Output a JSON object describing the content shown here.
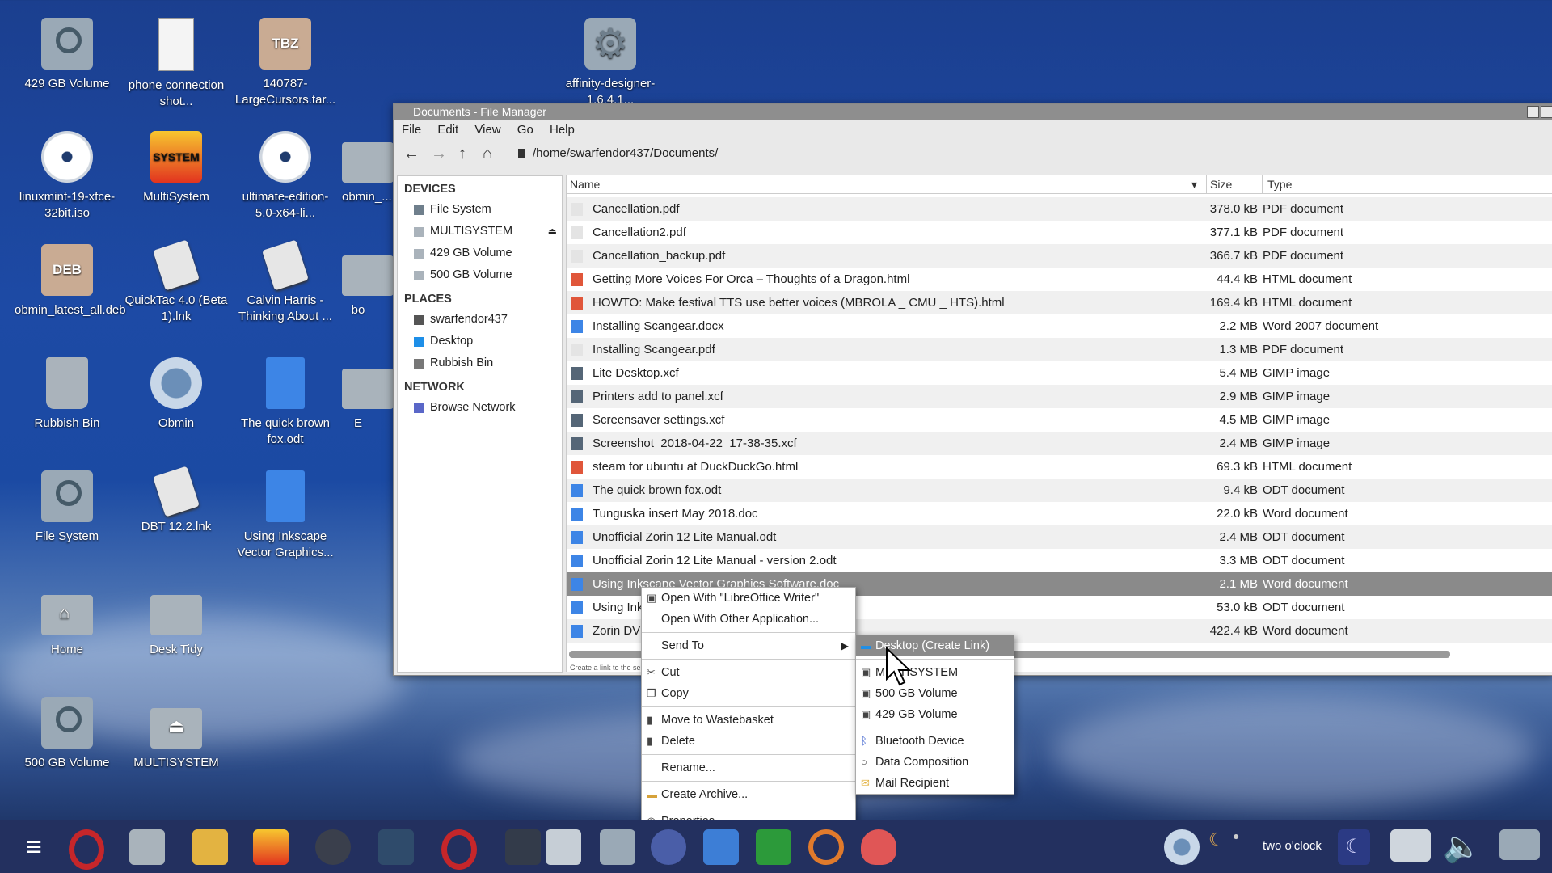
{
  "desktop": {
    "icons": [
      {
        "label": "429 GB Volume",
        "icon": "drive-icon"
      },
      {
        "label": "phone connection shot...",
        "icon": "image-file-icon"
      },
      {
        "label": "140787-LargeCursors.tar...",
        "icon": "archive-tbz-icon",
        "badge": "TBZ"
      },
      {
        "label": "affinity-designer-1.6.4.1...",
        "icon": "gear-icon"
      },
      {
        "label": "linuxmint-19-xfce-32bit.iso",
        "icon": "disc-icon"
      },
      {
        "label": "MultiSystem",
        "icon": "multisystem-icon",
        "badge": "SYSTEM"
      },
      {
        "label": "ultimate-edition-5.0-x64-li...",
        "icon": "disc-icon"
      },
      {
        "label": "obmin_...",
        "icon": "folder-icon"
      },
      {
        "label": "obmin_latest_all.deb",
        "icon": "deb-package-icon",
        "badge": "DEB"
      },
      {
        "label": "QuickTac 4.0 (Beta 1).lnk",
        "icon": "link-file-icon"
      },
      {
        "label": "Calvin Harris - Thinking About ...",
        "icon": "link-file-icon"
      },
      {
        "label": "bo",
        "icon": "folder-icon"
      },
      {
        "label": "Rubbish Bin",
        "icon": "trash-icon"
      },
      {
        "label": "Obmin",
        "icon": "obmin-icon"
      },
      {
        "label": "The quick brown fox.odt",
        "icon": "document-icon"
      },
      {
        "label": "E",
        "icon": "folder-icon"
      },
      {
        "label": "File System",
        "icon": "drive-icon"
      },
      {
        "label": "DBT 12.2.lnk",
        "icon": "link-file-icon"
      },
      {
        "label": "Using Inkscape Vector Graphics...",
        "icon": "document-icon"
      },
      {
        "label": "Home",
        "icon": "home-folder-icon"
      },
      {
        "label": "Desk Tidy",
        "icon": "folder-icon"
      },
      {
        "label": "500 GB Volume",
        "icon": "drive-icon"
      },
      {
        "label": "MULTISYSTEM",
        "icon": "eject-drive-icon"
      }
    ]
  },
  "window": {
    "title": "Documents - File Manager",
    "menu": [
      "File",
      "Edit",
      "View",
      "Go",
      "Help"
    ],
    "path": "/home/swarfendor437/Documents/",
    "sidebar": {
      "devices_title": "DEVICES",
      "devices": [
        "File System",
        "MULTISYSTEM",
        "429 GB Volume",
        "500 GB Volume"
      ],
      "places_title": "PLACES",
      "places": [
        "swarfendor437",
        "Desktop",
        "Rubbish Bin"
      ],
      "network_title": "NETWORK",
      "network": [
        "Browse Network"
      ]
    },
    "columns": {
      "name": "Name",
      "size": "Size",
      "type": "Type"
    },
    "files": [
      {
        "name": "Cancellation.pdf",
        "size": "378.0 kB",
        "type": "PDF document",
        "icon": "pdf-icon"
      },
      {
        "name": "Cancellation2.pdf",
        "size": "377.1 kB",
        "type": "PDF document",
        "icon": "pdf-icon"
      },
      {
        "name": "Cancellation_backup.pdf",
        "size": "366.7 kB",
        "type": "PDF document",
        "icon": "pdf-icon"
      },
      {
        "name": "Getting More Voices For Orca – Thoughts of a Dragon.html",
        "size": "44.4 kB",
        "type": "HTML document",
        "icon": "html-icon"
      },
      {
        "name": "HOWTO: Make festival TTS use better voices (MBROLA _ CMU _ HTS).html",
        "size": "169.4 kB",
        "type": "HTML document",
        "icon": "html-icon"
      },
      {
        "name": "Installing Scangear.docx",
        "size": "2.2 MB",
        "type": "Word 2007 document",
        "icon": "word-icon"
      },
      {
        "name": "Installing Scangear.pdf",
        "size": "1.3 MB",
        "type": "PDF document",
        "icon": "pdf-icon"
      },
      {
        "name": "Lite Desktop.xcf",
        "size": "5.4 MB",
        "type": "GIMP image",
        "icon": "gimp-icon"
      },
      {
        "name": "Printers add to panel.xcf",
        "size": "2.9 MB",
        "type": "GIMP image",
        "icon": "gimp-icon"
      },
      {
        "name": "Screensaver settings.xcf",
        "size": "4.5 MB",
        "type": "GIMP image",
        "icon": "gimp-icon"
      },
      {
        "name": "Screenshot_2018-04-22_17-38-35.xcf",
        "size": "2.4 MB",
        "type": "GIMP image",
        "icon": "gimp-icon"
      },
      {
        "name": "steam for ubuntu at DuckDuckGo.html",
        "size": "69.3 kB",
        "type": "HTML document",
        "icon": "html-icon"
      },
      {
        "name": "The quick brown fox.odt",
        "size": "9.4 kB",
        "type": "ODT document",
        "icon": "odt-icon"
      },
      {
        "name": "Tunguska insert May 2018.doc",
        "size": "22.0 kB",
        "type": "Word document",
        "icon": "word-icon"
      },
      {
        "name": "Unofficial Zorin 12 Lite Manual.odt",
        "size": "2.4 MB",
        "type": "ODT document",
        "icon": "odt-icon"
      },
      {
        "name": "Unofficial Zorin 12 Lite Manual - version 2.odt",
        "size": "3.3 MB",
        "type": "ODT document",
        "icon": "odt-icon"
      },
      {
        "name": "Using Inkscape Vector Graphics Software.doc",
        "size": "2.1 MB",
        "type": "Word document",
        "icon": "word-icon",
        "selected": true
      },
      {
        "name": "Using Ink",
        "size": "53.0 kB",
        "type": "ODT document",
        "icon": "odt-icon"
      },
      {
        "name": "Zorin DV",
        "size": "422.4 kB",
        "type": "Word document",
        "icon": "word-icon"
      }
    ],
    "status": "Create a link to the se..."
  },
  "context_menu": {
    "items": [
      {
        "label": "Open With \"LibreOffice Writer\"",
        "icon": "writer-icon"
      },
      {
        "label": "Open With Other Application...",
        "icon": ""
      },
      {
        "sep": true
      },
      {
        "label": "Send To",
        "icon": "",
        "submenu": true
      },
      {
        "sep": true
      },
      {
        "label": "Cut",
        "icon": "cut-icon"
      },
      {
        "label": "Copy",
        "icon": "copy-icon"
      },
      {
        "sep": true
      },
      {
        "label": "Move to Wastebasket",
        "icon": "trash-icon"
      },
      {
        "label": "Delete",
        "icon": "delete-icon"
      },
      {
        "sep": true
      },
      {
        "label": "Rename...",
        "icon": ""
      },
      {
        "sep": true
      },
      {
        "label": "Create Archive...",
        "icon": "archive-icon"
      },
      {
        "sep": true
      },
      {
        "label": "Properties...",
        "icon": "eye-icon"
      }
    ]
  },
  "submenu": {
    "items": [
      {
        "label": "Desktop (Create Link)",
        "icon": "desktop-icon",
        "highlight": true
      },
      {
        "sep": true
      },
      {
        "label": "MULTISYSTEM",
        "icon": "drive-icon"
      },
      {
        "label": "500 GB Volume",
        "icon": "drive-icon"
      },
      {
        "label": "429 GB Volume",
        "icon": "drive-icon"
      },
      {
        "sep": true
      },
      {
        "label": "Bluetooth Device",
        "icon": "bluetooth-icon"
      },
      {
        "label": "Data Composition",
        "icon": "disc-icon"
      },
      {
        "label": "Mail Recipient",
        "icon": "mail-icon"
      }
    ]
  },
  "taskbar": {
    "clock": "two o'clock"
  }
}
